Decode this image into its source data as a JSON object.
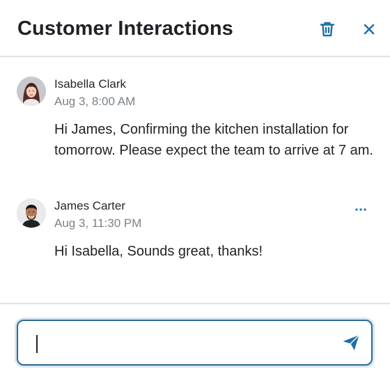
{
  "header": {
    "title": "Customer Interactions",
    "icons": {
      "delete": "trash-icon",
      "close": "close-icon"
    }
  },
  "messages": [
    {
      "author": "Isabella Clark",
      "timestamp": "Aug 3, 8:00 AM",
      "body": "Hi James, Confirming the kitchen installation for tomorrow. Please expect the team to arrive at 7 am."
    },
    {
      "author": "James Carter",
      "timestamp": "Aug 3, 11:30 PM",
      "body": "Hi Isabella, Sounds great, thanks!",
      "menu_icon": "more-horizontal-icon"
    }
  ],
  "composer": {
    "value": "",
    "placeholder": "",
    "send_icon": "send-icon"
  },
  "colors": {
    "accent": "#1f6fa3",
    "divider": "#dbe4ea",
    "title": "#1e2226",
    "muted": "#7a8188",
    "focus_border": "#2e6a93"
  }
}
